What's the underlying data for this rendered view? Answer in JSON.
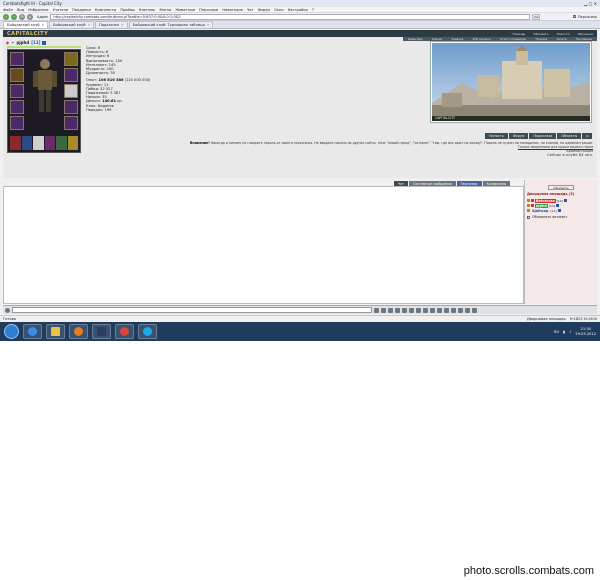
{
  "window": {
    "title": "Combatsfight III - Capital City"
  },
  "menu": [
    "Файл",
    "Вид",
    "Избранное",
    "Учатели",
    "Поединки",
    "Комплекты",
    "Пройвы",
    "Клетлюк",
    "Магна",
    "Живетные",
    "Персонаж",
    "Навигация",
    "Чат",
    "Форум",
    "Окно",
    "Настройки",
    "?"
  ],
  "nav": {
    "address_label": "Адрес",
    "url": "http://capitalcity.combats.com/buttons.pl?battle=0:857:0:0&0:0:1:0&2",
    "go": "Go",
    "right_label": "Персонаж"
  },
  "tabs": [
    {
      "label": "Бойцовский клуб"
    },
    {
      "label": "Бойцовский клуб"
    },
    {
      "label": "Подсказка"
    },
    {
      "label": "Бойцовский клуб: Турнирная таблица"
    }
  ],
  "game": {
    "logo": "CAPITALCITY",
    "top_links": [
      "Помощь",
      "Обновить",
      "Новости",
      "Обучение"
    ],
    "sub_links": [
      "Инвентарь",
      "Умения",
      "Задания",
      "Мой Аукцион",
      "Отчет о переводах",
      "Позиция",
      "Анкета",
      "Наставники"
    ],
    "character": {
      "name": "pjphd",
      "level": "[11]"
    },
    "stats": {
      "base": [
        "Сила: 6",
        "Ловкость: 6",
        "Интуиция: 6",
        "Выносливость: 100",
        "Интеллект: 145",
        "Мудрость: 100",
        "Духовность: 50"
      ],
      "exp": {
        "label": "Опыт:",
        "value": "106 816 386",
        "extra": "(120 000 000)"
      },
      "rest": [
        "Уровень: 11",
        "Побед: 32 527",
        "Поражений: 5 387",
        "Ничьих: 35"
      ],
      "money": {
        "label": "Деньги:",
        "value": "140.61",
        "unit": "кр."
      },
      "tail": [
        "Клан: Negative",
        "Передач: 199"
      ]
    },
    "scene_caption": "CAPITALCITY",
    "buttons": [
      "Напасть",
      "Форум",
      "Подсказка",
      "Объекты",
      "р"
    ],
    "notice": {
      "strong": "Внимание!",
      "text": "Никогда и никому не говорите пароль от своего персонажа. Не вводите пароль на другие сайты, типа \"новый город\", \"лотерея\", \"там, где все дают на халяву\". Пароль не нужен ни паладинам, ни кланам, ни администрации.",
      "line2": "Только мошенники для кражи вашего героя",
      "line3": "Администрация",
      "online": "Сейчас в клубе 84 чел."
    },
    "chat_tabs": [
      "Чат",
      "Системные сообщения",
      "Персонаж",
      "Конфиланы"
    ],
    "panel": {
      "refresh": "Обновить",
      "location": "Дворцовая площадь (3)",
      "players": [
        {
          "name": "Belvaryaz",
          "level": "[10]",
          "style": "red"
        },
        {
          "name": "pjphd",
          "level": "[11]",
          "style": "grn"
        },
        {
          "name": "Ajalhcap",
          "level": "[11]",
          "style": "plain"
        }
      ],
      "auto_refresh": "Обновлять автомат."
    }
  },
  "status": {
    "left": "Готово",
    "center": "Дворцовая площадь",
    "right": "H:1825 N:1500"
  },
  "taskbar": {
    "lang": "RU",
    "time": "21:30",
    "date": "29.03.2012",
    "apps": [
      "ie",
      "folder",
      "media",
      "cf",
      "chrome",
      "skype"
    ]
  },
  "watermark": "photo.scrolls.combats.com"
}
